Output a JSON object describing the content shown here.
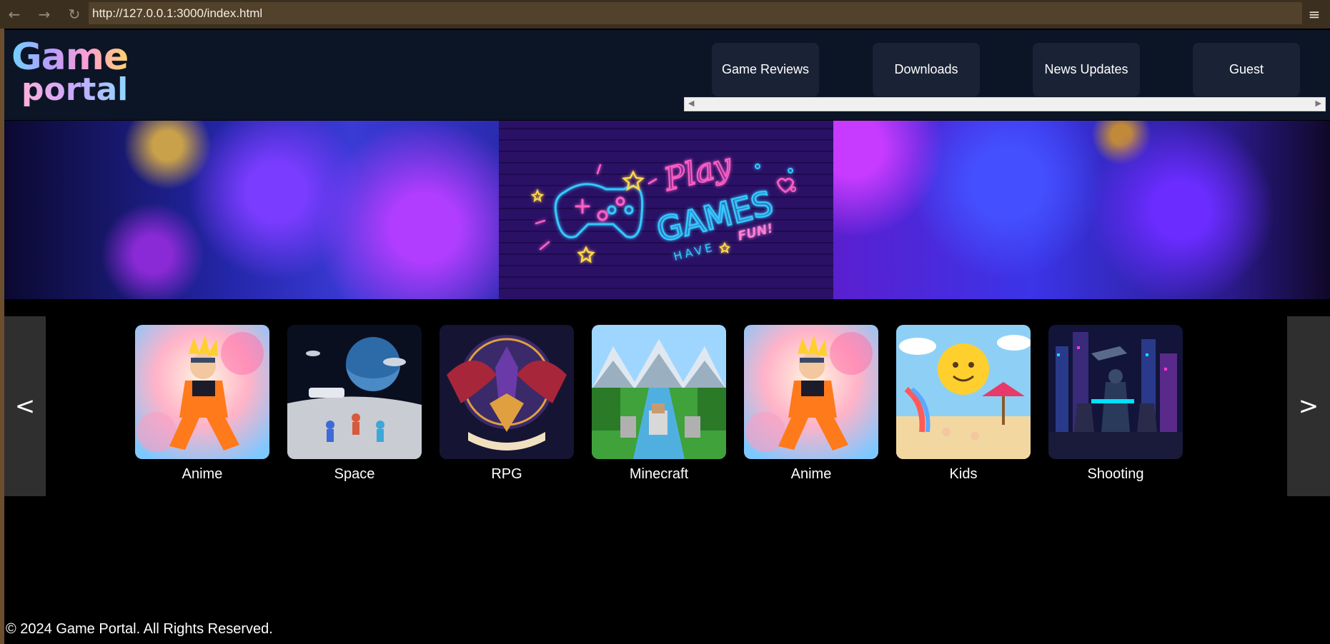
{
  "browser": {
    "url": "http://127.0.0.1:3000/index.html",
    "back_icon": "←",
    "forward_icon": "→",
    "reload_icon": "↻",
    "menu_icon": "≡"
  },
  "logo": {
    "line1": "Game",
    "line2": "portal"
  },
  "nav": {
    "items": [
      "Game Reviews",
      "Downloads",
      "News Updates",
      "Guest"
    ]
  },
  "banner": {
    "word1": "Play",
    "word2": "GAMES",
    "word3": "HAVE",
    "word4": "FUN!"
  },
  "carousel": {
    "prev": "<",
    "next": ">",
    "cards": [
      {
        "label": "Anime"
      },
      {
        "label": "Space"
      },
      {
        "label": "RPG"
      },
      {
        "label": "Minecraft"
      },
      {
        "label": "Anime"
      },
      {
        "label": "Kids"
      },
      {
        "label": "Shooting"
      }
    ]
  },
  "footer": {
    "text": "© 2024 Game Portal. All Rights Reserved."
  },
  "colors": {
    "chrome": "#3b2f1f",
    "header": "#0c1526",
    "nav_button": "#1a2336"
  }
}
